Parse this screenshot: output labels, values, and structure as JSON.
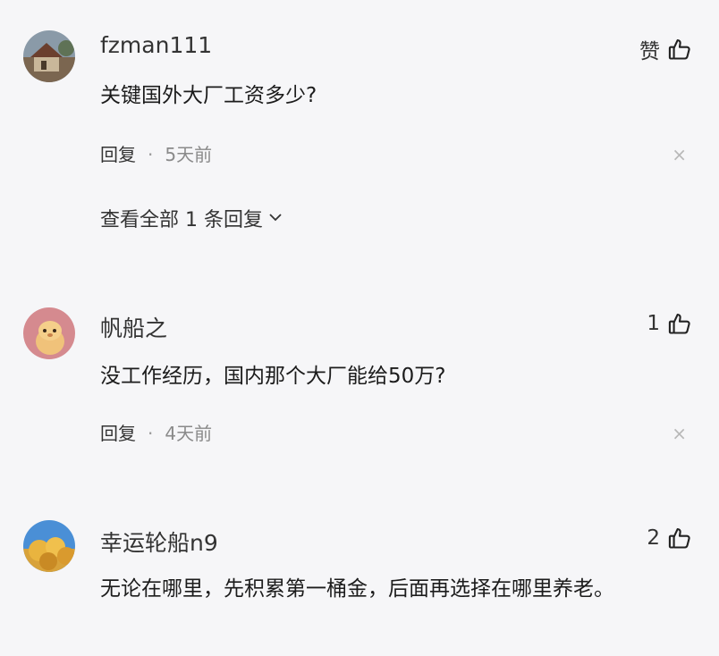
{
  "comments": [
    {
      "username": "fzman111",
      "text": "关键国外大厂工资多少?",
      "likes": "赞",
      "reply_label": "回复",
      "dot": "·",
      "time": "5天前",
      "close": "×",
      "view_replies": "查看全部 1 条回复"
    },
    {
      "username": "帆船之",
      "text": "没工作经历，国内那个大厂能给50万?",
      "likes": "1",
      "reply_label": "回复",
      "dot": "·",
      "time": "4天前",
      "close": "×"
    },
    {
      "username": "幸运轮船n9",
      "text": "无论在哪里，先积累第一桶金，后面再选择在哪里养老。",
      "likes": "2"
    }
  ],
  "icons": {
    "like": "thumbs-up-icon",
    "close": "close-icon",
    "expand": "chevron-down-icon"
  }
}
